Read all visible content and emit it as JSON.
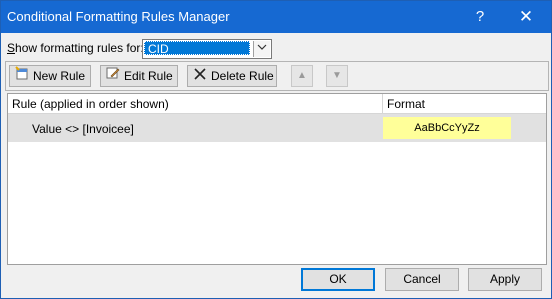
{
  "window": {
    "title": "Conditional Formatting Rules Manager",
    "help_glyph": "?",
    "close_glyph": "✕"
  },
  "filter": {
    "label": "Show formatting rules for:",
    "selected": "CID"
  },
  "toolbar": {
    "new_rule": "New Rule",
    "edit_rule": "Edit Rule",
    "delete_rule": "Delete Rule",
    "move_up_glyph": "▲",
    "move_down_glyph": "▼"
  },
  "grid": {
    "columns": [
      "Rule (applied in order shown)",
      "Format"
    ],
    "rows": [
      {
        "rule": "Value <> [Invoicee]",
        "format_preview": "AaBbCcYyZz",
        "format_fill": "#ffff99"
      }
    ]
  },
  "buttons": {
    "ok": "OK",
    "cancel": "Cancel",
    "apply": "Apply"
  },
  "colors": {
    "titlebar": "#1669d2",
    "selection": "#0078d7"
  },
  "icons": {
    "new_rule": "new-rule-icon",
    "edit_rule": "edit-rule-icon",
    "delete_rule": "delete-x-icon",
    "move_up": "move-up-arrow-icon",
    "move_down": "move-down-arrow-icon",
    "dropdown": "chevron-down-icon"
  }
}
